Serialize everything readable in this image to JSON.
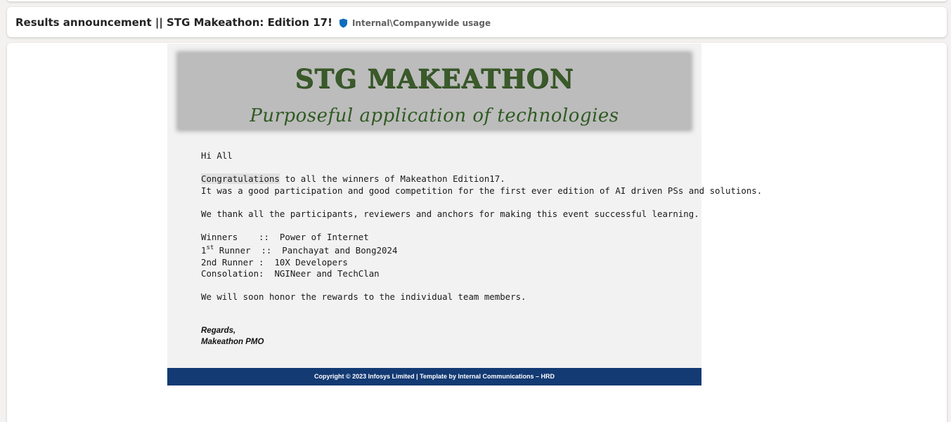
{
  "header": {
    "subject": "Results announcement || STG Makeathon: Edition 17!",
    "sensitivity_label": "Internal\\Companywide usage",
    "sensitivity_icon": "shield-icon",
    "sensitivity_color": "#0f6cbd"
  },
  "banner": {
    "title": "STG MAKEATHON",
    "tagline": "Purposeful application of technologies"
  },
  "message": {
    "greeting": "Hi All",
    "congrats_word": "Congratulations",
    "congrats_rest": " to all the winners of Makeathon Edition17.",
    "participation_line": "It was a good participation and good competition for the first ever edition of AI driven PSs and solutions.",
    "thanks_line": "We thank all the participants, reviewers and anchors for making this event successful learning.",
    "winners": {
      "winners_label": "Winners    ::  ",
      "winners_value": "Power of Internet",
      "first_runner_prefix": "1",
      "first_runner_sup": "st",
      "first_runner_label": " Runner  ::  ",
      "first_runner_value": "Panchayat and Bong2024",
      "second_runner_label": "2nd Runner :  ",
      "second_runner_value": "10X Developers",
      "consolation_label": "Consolation:  ",
      "consolation_value": "NGINeer and TechClan"
    },
    "rewards_line": "We will soon honor the rewards to the individual team members."
  },
  "signature": {
    "regards": "Regards,",
    "sender": "Makeathon PMO"
  },
  "footer": {
    "text": "Copyright © 2023 Infosys Limited | Template by Internal Communications – HRD",
    "background": "#133a73"
  }
}
